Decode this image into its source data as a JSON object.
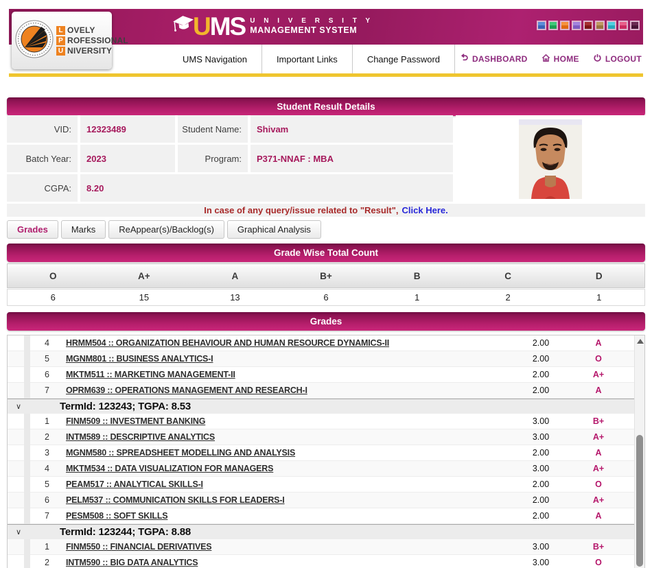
{
  "header": {
    "lpu_logo_lines": [
      {
        "initial": "L",
        "rest": "OVELY"
      },
      {
        "initial": "P",
        "rest": "ROFESSIONAL"
      },
      {
        "initial": "U",
        "rest": "NIVERSITY"
      }
    ],
    "ums_logo": {
      "u": "U",
      "ms": "MS",
      "line1": "U N I V E R S I T Y",
      "line2": "MANAGEMENT SYSTEM"
    },
    "palette_squares": [
      {
        "top": "#5b8dd9",
        "bottom": "#3a63b8"
      },
      {
        "top": "#3fc878",
        "bottom": "#1e9e52"
      },
      {
        "top": "#f5923e",
        "bottom": "#e06a10"
      },
      {
        "top": "#a284dd",
        "bottom": "#7d5cc0"
      },
      {
        "top": "#a63030",
        "bottom": "#7c1616"
      },
      {
        "top": "#c09a62",
        "bottom": "#9a7340"
      },
      {
        "top": "#4fd0e0",
        "bottom": "#25a8bc"
      },
      {
        "top": "#e85f8a",
        "bottom": "#cc2a60"
      },
      {
        "top": "#6a2a52",
        "bottom": "#471536"
      }
    ],
    "nav": [
      "UMS Navigation",
      "Important Links",
      "Change Password"
    ],
    "quick_links": [
      {
        "icon": "dashboard-icon",
        "label": "DASHBOARD"
      },
      {
        "icon": "home-icon",
        "label": "HOME"
      },
      {
        "icon": "logout-icon",
        "label": "LOGOUT"
      }
    ]
  },
  "result_panel": {
    "title": "Student Result Details",
    "fields": {
      "vid_label": "VID:",
      "vid_value": "12323489",
      "name_label": "Student Name:",
      "name_value": "Shivam",
      "batch_label": "Batch Year:",
      "batch_value": "2023",
      "program_label": "Program:",
      "program_value": "P371-NNAF : MBA",
      "cgpa_label": "CGPA:",
      "cgpa_value": "8.20"
    },
    "query_note": {
      "text": "In case of any query/issue related to \"Result\",",
      "link": "Click Here."
    }
  },
  "tabs": [
    {
      "label": "Grades",
      "active": true
    },
    {
      "label": "Marks",
      "active": false
    },
    {
      "label": "ReAppear(s)/Backlog(s)",
      "active": false
    },
    {
      "label": "Graphical Analysis",
      "active": false
    }
  ],
  "grade_count": {
    "title": "Grade Wise Total Count",
    "grades": [
      "O",
      "A+",
      "A",
      "B+",
      "B",
      "C",
      "D"
    ],
    "counts": [
      "6",
      "15",
      "13",
      "6",
      "1",
      "2",
      "1"
    ]
  },
  "grades_section": {
    "title": "Grades",
    "items": [
      {
        "type": "course",
        "sno": "4",
        "name": "HRMM504 :: ORGANIZATION BEHAVIOUR AND HUMAN RESOURCE DYNAMICS-II",
        "credits": "2.00",
        "grade": "A"
      },
      {
        "type": "course",
        "sno": "5",
        "name": "MGNM801 :: BUSINESS ANALYTICS-I",
        "credits": "2.00",
        "grade": "O"
      },
      {
        "type": "course",
        "sno": "6",
        "name": "MKTM511 :: MARKETING MANAGEMENT-II",
        "credits": "2.00",
        "grade": "A+"
      },
      {
        "type": "course",
        "sno": "7",
        "name": "OPRM639 :: OPERATIONS MANAGEMENT AND RESEARCH-I",
        "credits": "2.00",
        "grade": "A"
      },
      {
        "type": "term",
        "label": "TermId: 123243; TGPA: 8.53"
      },
      {
        "type": "course",
        "sno": "1",
        "name": "FINM509 :: INVESTMENT BANKING",
        "credits": "3.00",
        "grade": "B+"
      },
      {
        "type": "course",
        "sno": "2",
        "name": "INTM589 :: DESCRIPTIVE ANALYTICS",
        "credits": "3.00",
        "grade": "A+"
      },
      {
        "type": "course",
        "sno": "3",
        "name": "MGNM580 :: SPREADSHEET MODELLING AND ANALYSIS",
        "credits": "2.00",
        "grade": "A"
      },
      {
        "type": "course",
        "sno": "4",
        "name": "MKTM534 :: DATA VISUALIZATION FOR MANAGERS",
        "credits": "3.00",
        "grade": "A+"
      },
      {
        "type": "course",
        "sno": "5",
        "name": "PEAM517 :: ANALYTICAL SKILLS-I",
        "credits": "2.00",
        "grade": "O"
      },
      {
        "type": "course",
        "sno": "6",
        "name": "PELM537 :: COMMUNICATION SKILLS FOR LEADERS-I",
        "credits": "2.00",
        "grade": "A+"
      },
      {
        "type": "course",
        "sno": "7",
        "name": "PESM508 :: SOFT SKILLS",
        "credits": "2.00",
        "grade": "A"
      },
      {
        "type": "term",
        "label": "TermId: 123244; TGPA: 8.88"
      },
      {
        "type": "course",
        "sno": "1",
        "name": "FINM550 :: FINANCIAL DERIVATIVES",
        "credits": "3.00",
        "grade": "B+"
      },
      {
        "type": "course",
        "sno": "2",
        "name": "INTM590 :: BIG DATA ANALYTICS",
        "credits": "3.00",
        "grade": "O"
      }
    ]
  },
  "colors": {
    "accent": "#b41e6b",
    "yellow_rule": "#efc52f",
    "value_text": "#a6195c",
    "grade_text": "#b5176b"
  }
}
